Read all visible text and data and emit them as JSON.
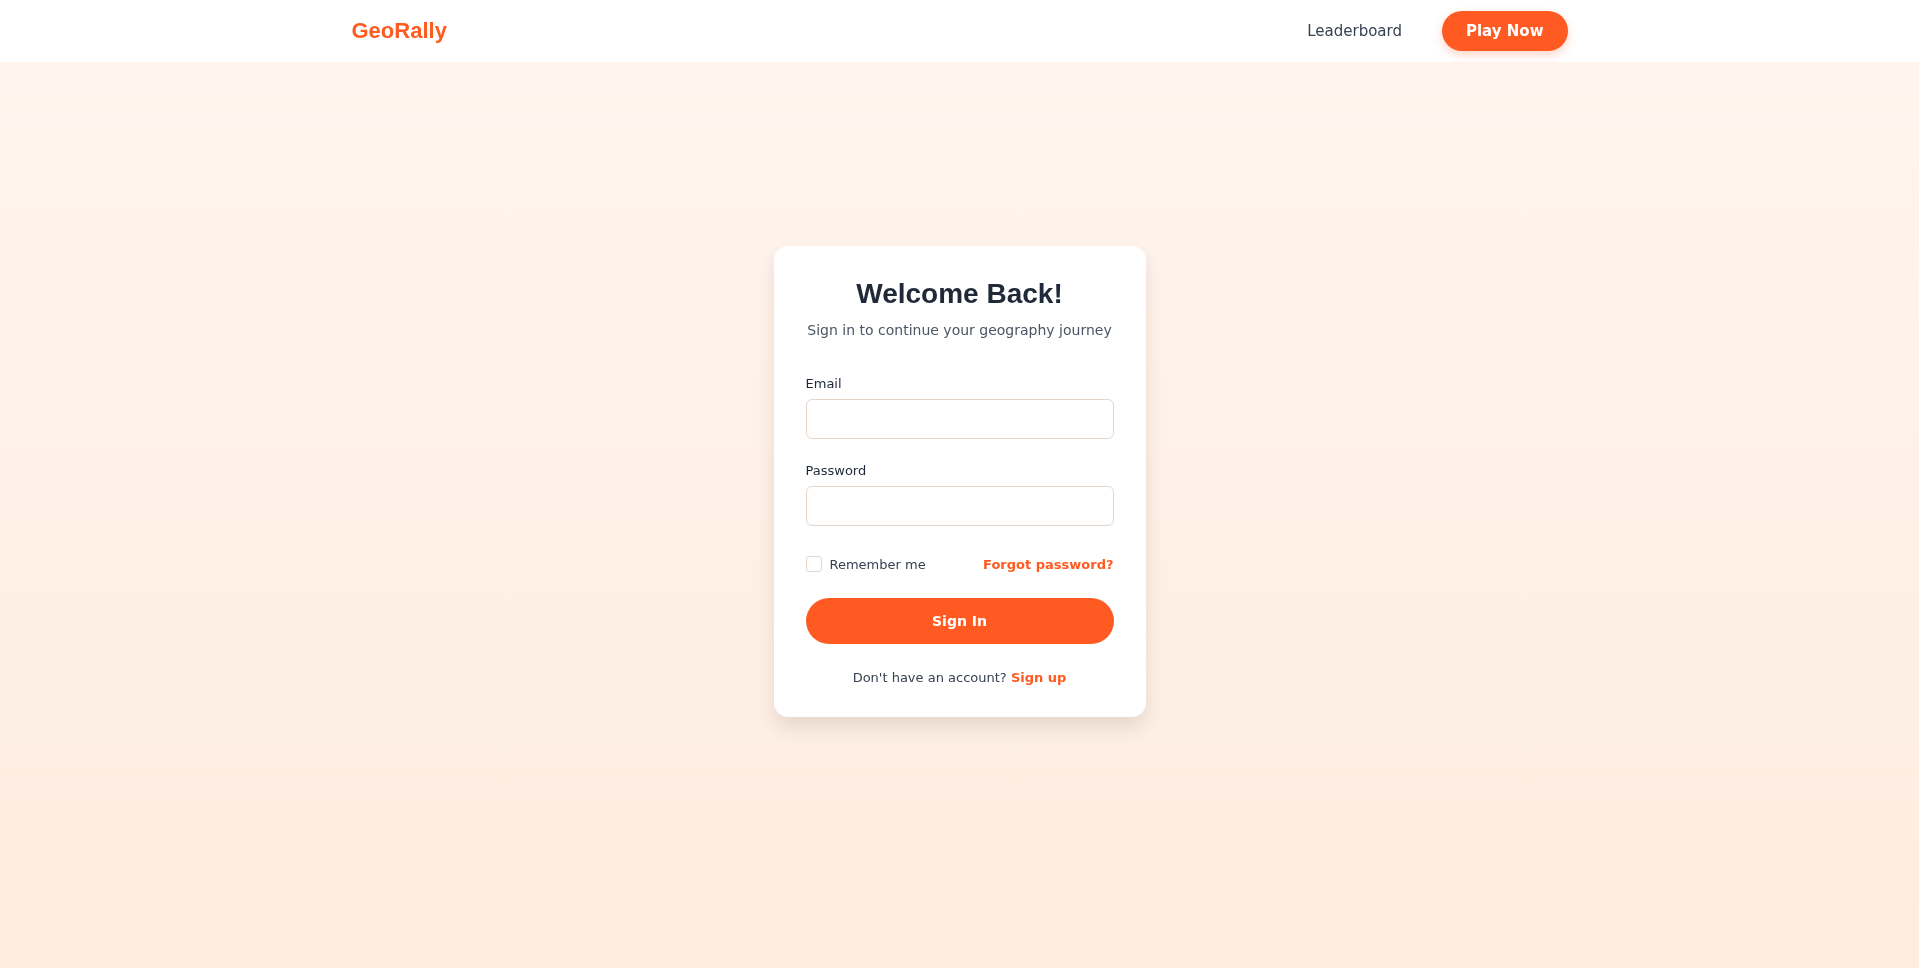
{
  "header": {
    "logo": "GeoRally",
    "nav_link": "Leaderboard",
    "cta": "Play Now"
  },
  "login": {
    "title": "Welcome Back!",
    "subtitle": "Sign in to continue your geography journey",
    "fields": [
      {
        "label": "Email"
      },
      {
        "label": "Password"
      }
    ],
    "remember": {
      "label": "Remember me",
      "checked": false
    },
    "forgot": "Forgot password?",
    "submit": "Sign In",
    "signup_prompt": "Don't have an account?",
    "signup_link": "Sign up"
  }
}
